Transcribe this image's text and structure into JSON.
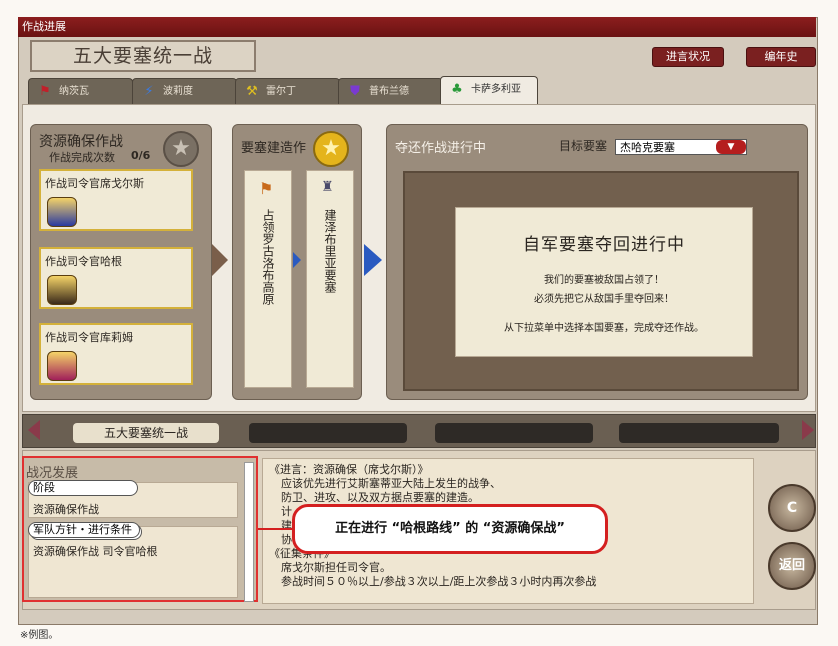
{
  "window": {
    "title": "作战进展"
  },
  "header": {
    "page_title": "五大要塞统一战",
    "btn_report": "进言状况",
    "btn_history": "编年史"
  },
  "tabs": [
    {
      "label": "纳茨瓦",
      "icon": "flag-icon"
    },
    {
      "label": "波莉度",
      "icon": "lightning-icon"
    },
    {
      "label": "雷尔丁",
      "icon": "hammer-icon"
    },
    {
      "label": "普布兰德",
      "icon": "shield-icon"
    },
    {
      "label": "卡萨多利亚",
      "icon": "clover-icon"
    }
  ],
  "resource": {
    "title": "资源确保作战",
    "count_label": "作战完成次数",
    "count_value": "0/6",
    "commanders": [
      "作战司令官席戈尔斯",
      "作战司令官哈根",
      "作战司令官库莉姆"
    ]
  },
  "fortress": {
    "title": "要塞建造作",
    "cards": [
      "占领罗古洛布高原",
      "建泽布里亚要塞"
    ]
  },
  "recapture": {
    "title": "夺还作战进行中",
    "target_label": "目标要塞",
    "target_value": "杰哈克要塞",
    "message_title": "自军要塞夺回进行中",
    "message_lines": [
      "我们的要塞被敌国占领了！",
      "必须先把它从敌国手里夺回来！",
      "从下拉菜单中选择本国要塞，完成夺还作战。"
    ]
  },
  "timeline": {
    "active": "五大要塞统一战"
  },
  "progress": {
    "title": "战况发展",
    "stage_label": "阶段",
    "stage_value": "资源确保作战",
    "policy_label": "军队方针・进行条件",
    "policy_value": "资源确保作战  司令官哈根"
  },
  "info": {
    "lines": [
      "《进言：资源确保（席戈尔斯）》",
      "应该优先进行艾斯塞蒂亚大陆上发生的战争、",
      "防卫、进攻、以及双方据点要塞的建造。",
      "计",
      "建",
      "协",
      "《征集条件》",
      "席戈尔斯担任司令官。",
      "参战时间５０％以上/参战３次以上/距上次参战３小时内再次参战"
    ]
  },
  "callout": "正在进行 “哈根路线” 的 “资源确保战”",
  "buttons": {
    "refresh_label": "C",
    "back_label": "返回"
  },
  "footnote": "※例图。",
  "colors": {
    "accent": "#8c1e1e",
    "callout_border": "#d42020"
  }
}
